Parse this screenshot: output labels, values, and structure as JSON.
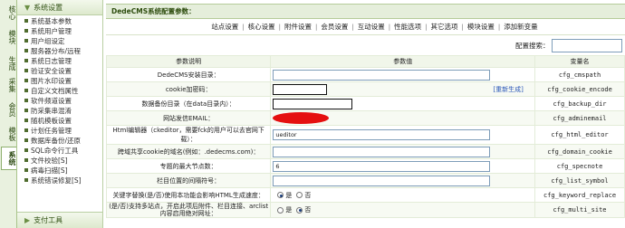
{
  "vtabs": [
    {
      "label": "核心",
      "active": false
    },
    {
      "label": "模块",
      "active": false
    },
    {
      "label": "生成",
      "active": false
    },
    {
      "label": "采集",
      "active": false
    },
    {
      "label": "会员",
      "active": false
    },
    {
      "label": "模板",
      "active": false
    },
    {
      "label": "系统",
      "active": true
    }
  ],
  "menu": {
    "header": "系统设置",
    "items": [
      "系统基本参数",
      "系统用户管理",
      "用户组设定",
      "服务器分布/远程",
      "系统日志管理",
      "验证安全设置",
      "图片水印设置",
      "自定义文档属性",
      "软件频道设置",
      "防采集串混淆",
      "随机模板设置",
      "计划任务管理",
      "数据库备份/还原",
      "SQL命令行工具",
      "文件校验[S]",
      "病毒扫描[S]",
      "系统错误修复[S]"
    ],
    "footer": "支付工具"
  },
  "title": "DedeCMS系统配置参数：",
  "tabs": [
    "站点设置",
    "核心设置",
    "附件设置",
    "会员设置",
    "互动设置",
    "性能选项",
    "其它选项",
    "模块设置",
    "添加新变量"
  ],
  "search": {
    "label": "配置搜索：",
    "value": ""
  },
  "table": {
    "headers": [
      "参数说明",
      "参数值",
      "变量名"
    ],
    "rows": [
      {
        "label": "DedeCMS安装目录：",
        "kind": "input",
        "value": "",
        "var": "cfg_cmspath"
      },
      {
        "label": "cookie加密码：",
        "kind": "input-black-link",
        "value": "",
        "link": "[重新生成]",
        "var": "cfg_cookie_encode"
      },
      {
        "label": "数据备份目录（在data目录内）：",
        "kind": "input-black",
        "value": "",
        "var": "cfg_backup_dir"
      },
      {
        "label": "网站发信EMAIL：",
        "kind": "redacted",
        "value": "",
        "var": "cfg_adminemail"
      },
      {
        "label": "Html编辑器（ckeditor，需要fck的用户可以去官网下载）：",
        "kind": "input",
        "value": "ueditor",
        "var": "cfg_html_editor"
      },
      {
        "label": "跨域共享cookie的域名(例如：.dedecms.com)：",
        "kind": "input",
        "value": "",
        "var": "cfg_domain_cookie"
      },
      {
        "label": "专题的最大节点数：",
        "kind": "input",
        "value": "6",
        "var": "cfg_specnote"
      },
      {
        "label": "栏目位置的间隔符号：",
        "kind": "input",
        "value": "",
        "var": "cfg_list_symbol"
      },
      {
        "label": "关键字替换(是/否)使用本功能会影响HTML生成速度：",
        "kind": "radio",
        "options": [
          "是",
          "否"
        ],
        "selected": 0,
        "var": "cfg_keyword_replace"
      },
      {
        "label": "(是/否)支持多站点，开启此项后附件、栏目连接、arclist内容启用绝对网址：",
        "kind": "radio",
        "options": [
          "是",
          "否"
        ],
        "selected": 1,
        "var": "cfg_multi_site"
      }
    ]
  }
}
